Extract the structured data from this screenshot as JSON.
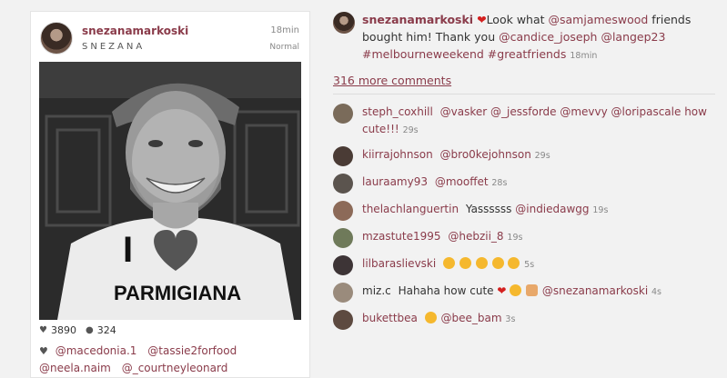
{
  "post": {
    "username": "snezanamarkoski",
    "full_name": "SNEZANA",
    "time": "18min",
    "filter": "Normal",
    "photo_text_line1": "I",
    "photo_text_line2": "PARMIGIANA",
    "likes": "3890",
    "comments_count": "324",
    "likers": [
      "@macedonia.1",
      "@tassie2forfood",
      "@neela.naim",
      "@_courtneyleonard"
    ]
  },
  "caption": {
    "username": "snezanamarkoski",
    "text_parts": [
      "Look what ",
      "@samjameswood",
      " friends bought him! Thank you ",
      "@candice_joseph",
      " ",
      "@langep23",
      " ",
      "#melbourneweekend",
      " ",
      "#greatfriends",
      " "
    ],
    "time": "18min"
  },
  "more_comments": "316 more comments",
  "comments": [
    {
      "user": "steph_coxhill",
      "text": "@vasker @_jessforde @mevvy @loripascale how cute!!!",
      "time": "29s",
      "avatar": "#7a6b5a"
    },
    {
      "user": "kiirrajohnson",
      "text": "@bro0kejohnson",
      "time": "29s",
      "avatar": "#4a3b35"
    },
    {
      "user": "lauraamy93",
      "text": "@mooffet",
      "time": "28s",
      "avatar": "#5b544e"
    },
    {
      "user": "thelachlanguertin",
      "text": "Yassssss @indiedawgg",
      "time": "19s",
      "avatar": "#8c6a58"
    },
    {
      "user": "mzastute1995",
      "text": "@hebzii_8",
      "time": "19s",
      "avatar": "#6f7a5a"
    },
    {
      "user": "lilbaraslievski",
      "text": "",
      "time": "5s",
      "avatar": "#3d3436"
    },
    {
      "user": "miz.c",
      "text": "Hahaha how cute",
      "text2": "@snezanamarkoski",
      "time": "4s",
      "avatar": "#9a8b7c"
    },
    {
      "user": "bukettbea",
      "text": "@bee_bam",
      "time": "3s",
      "avatar": "#5d4a40"
    }
  ],
  "colors": {
    "accent": "#8a3b4a",
    "heart": "#d4201f",
    "emoji": "#f5b82e"
  }
}
